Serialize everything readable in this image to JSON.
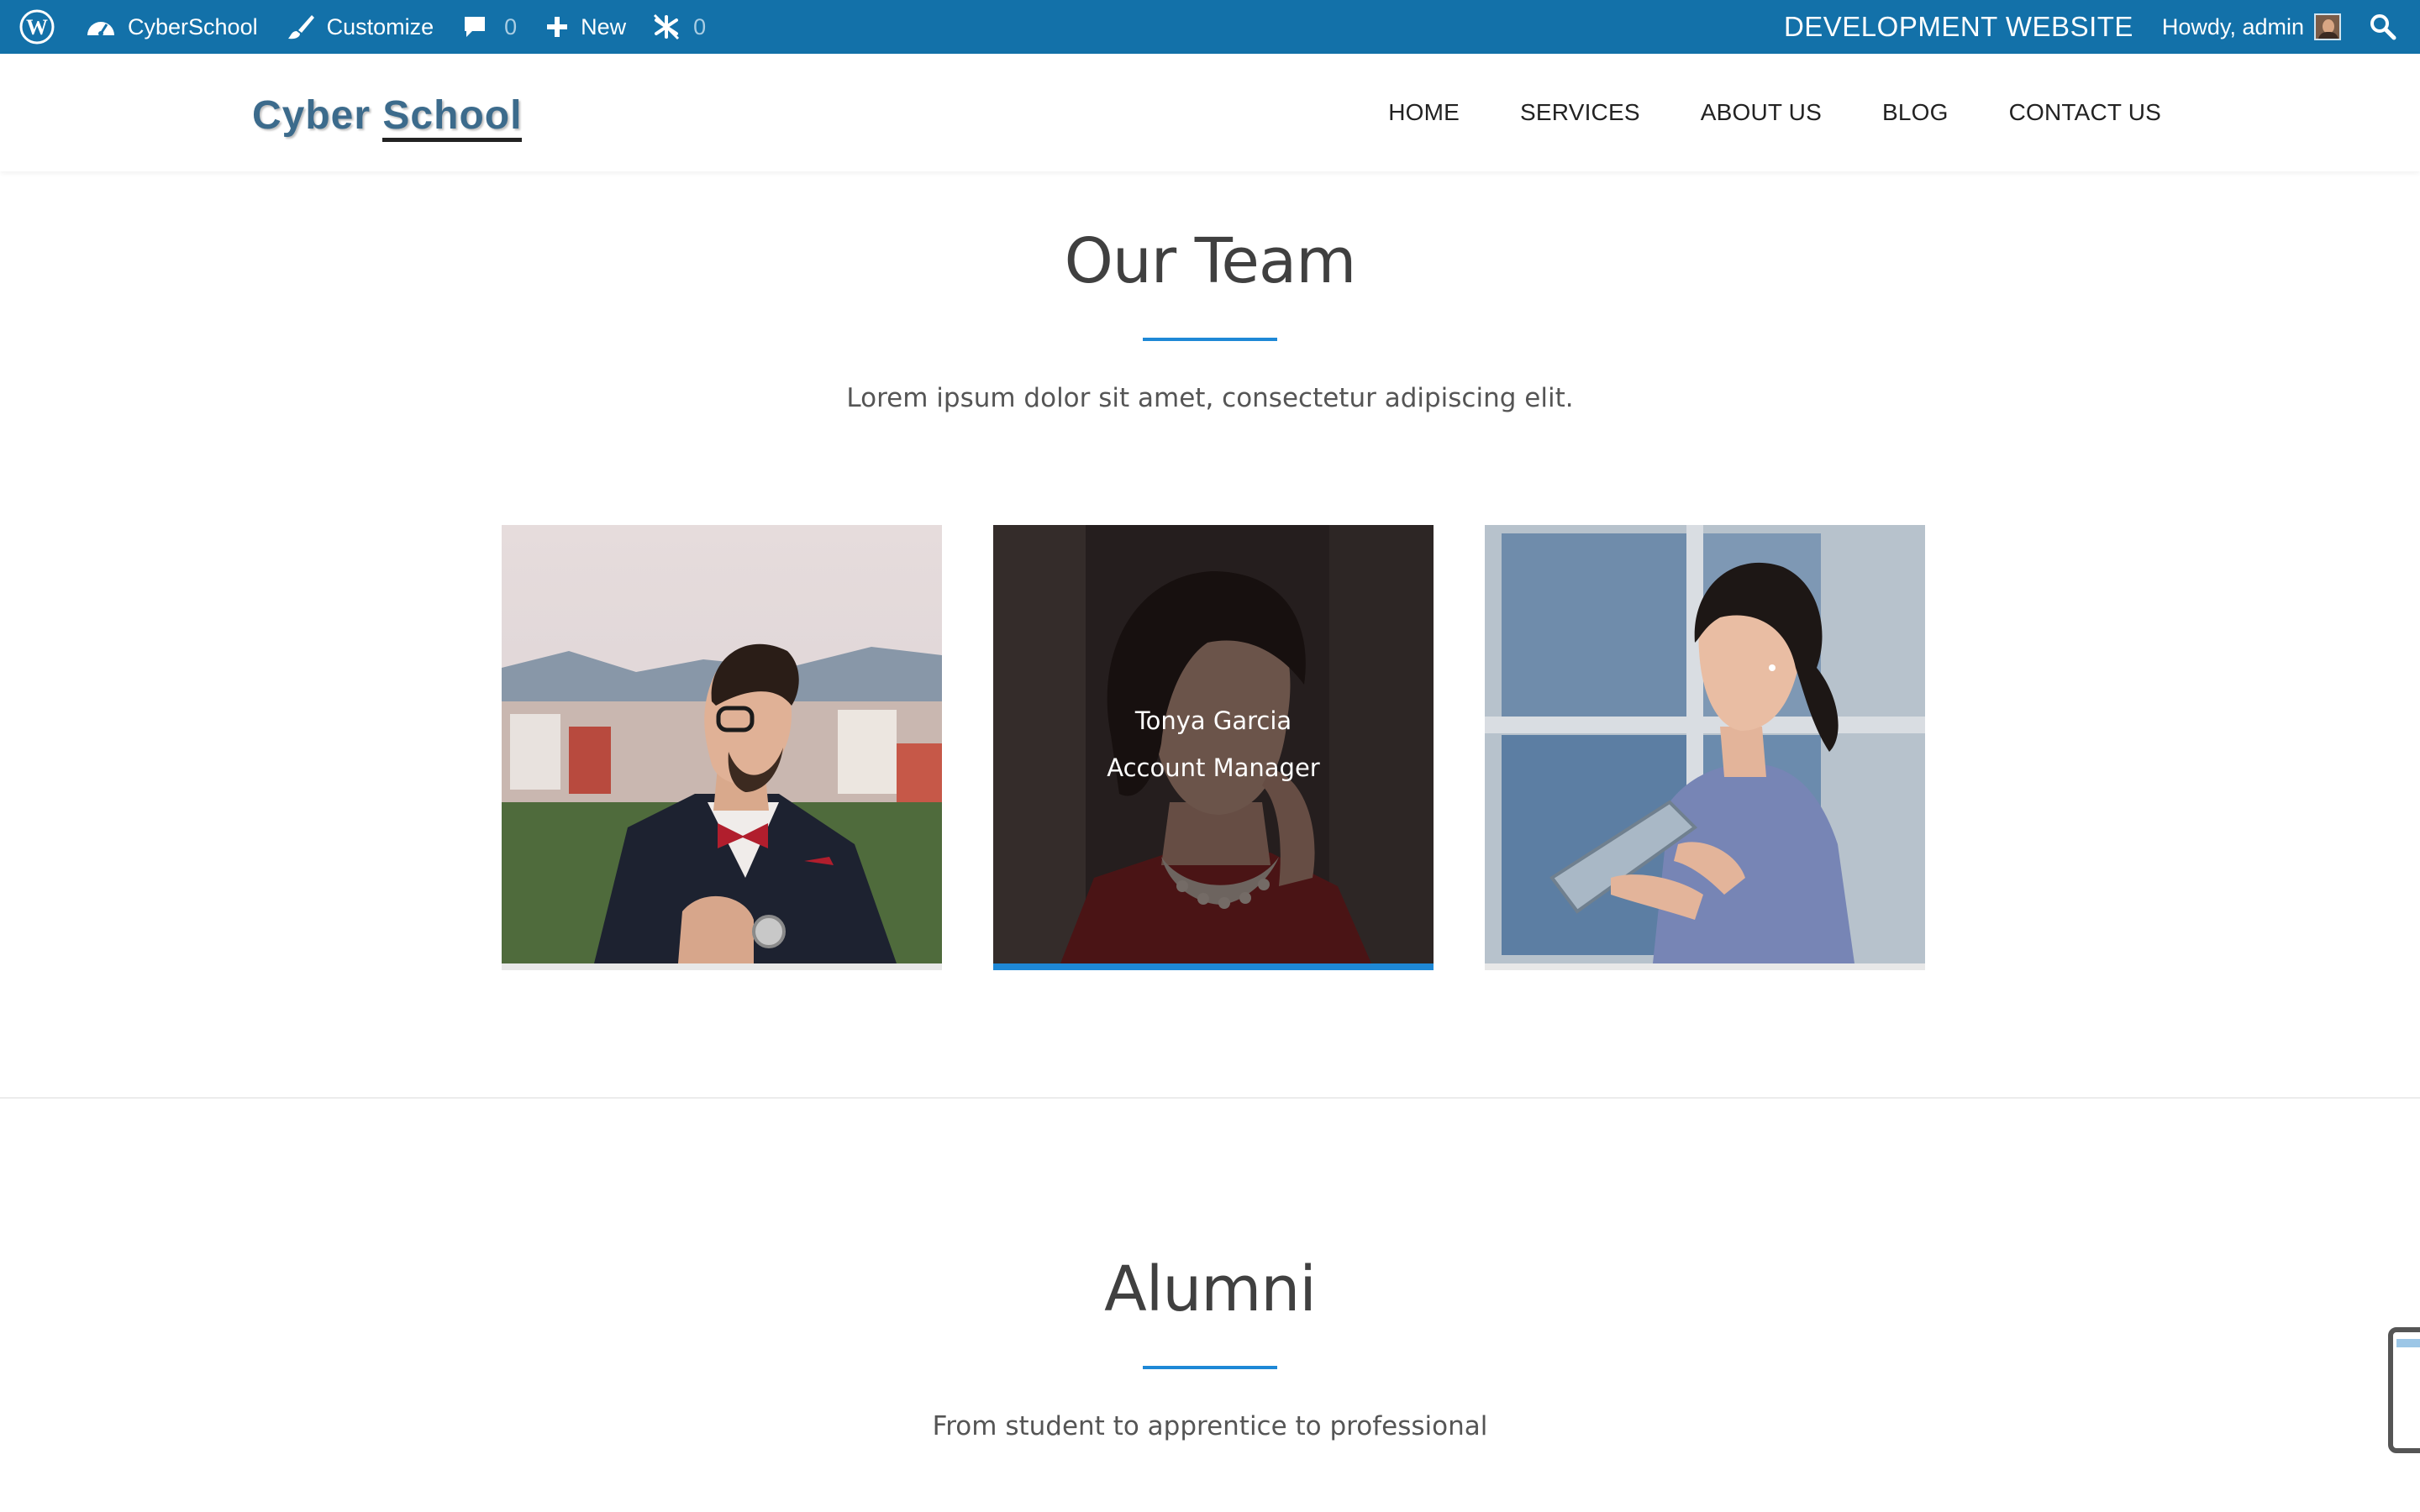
{
  "adminbar": {
    "site_name": "CyberSchool",
    "customize_label": "Customize",
    "comments_count": "0",
    "new_label": "New",
    "updates_count": "0",
    "environment_label": "DEVELOPMENT WEBSITE",
    "greeting": "Howdy, admin",
    "icons": [
      "wordpress-icon",
      "dashboard-icon",
      "brush-icon",
      "comment-icon",
      "plus-icon",
      "no-spam-icon",
      "search-icon"
    ]
  },
  "header": {
    "logo_first": "Cyber",
    "logo_second": "School",
    "nav": [
      "HOME",
      "SERVICES",
      "ABOUT US",
      "BLOG",
      "CONTACT US"
    ]
  },
  "team": {
    "title": "Our Team",
    "subtitle": "Lorem ipsum dolor sit amet, consectetur adipiscing elit.",
    "members": [
      {
        "name": "",
        "role": ""
      },
      {
        "name": "Tonya Garcia",
        "role": "Account Manager"
      },
      {
        "name": "",
        "role": ""
      }
    ]
  },
  "alumni": {
    "title": "Alumni",
    "subtitle": "From student to apprentice to professional"
  },
  "colors": {
    "adminbar_bg": "#1371a9",
    "accent": "#1e88d6",
    "heading": "#404040"
  }
}
